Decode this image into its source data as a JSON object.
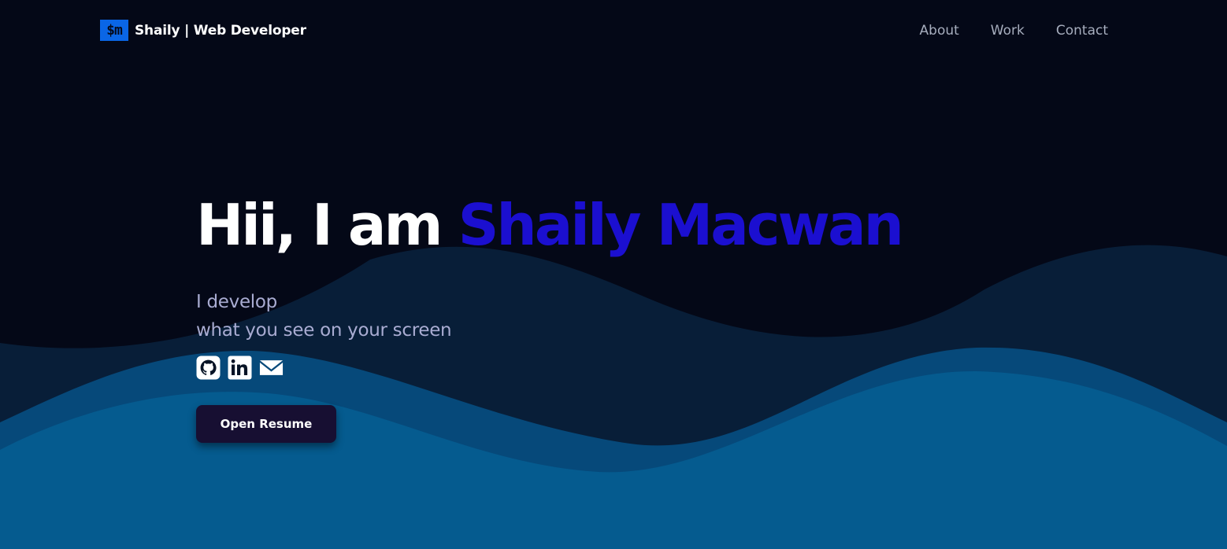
{
  "brand": {
    "logo_text": "$m",
    "name": "Shaily  | Web Developer"
  },
  "nav": {
    "links": [
      {
        "label": "About"
      },
      {
        "label": "Work"
      },
      {
        "label": "Contact"
      }
    ]
  },
  "hero": {
    "greeting": "Hii, I am",
    "name": "Shaily Macwan",
    "tagline_line1": "I develop",
    "tagline_line2": "what you see on your screen",
    "socials": [
      {
        "icon": "github-icon"
      },
      {
        "icon": "linkedin-icon"
      },
      {
        "icon": "mail-icon"
      }
    ],
    "resume_button": "Open Resume"
  },
  "colors": {
    "background": "#040817",
    "accent_name": "#1b0fd0",
    "brand_logo": "#0a66e6",
    "wave_back": "#081e38",
    "wave_mid": "#06497a",
    "wave_front": "#055b8f",
    "button_bg": "#170f32"
  }
}
